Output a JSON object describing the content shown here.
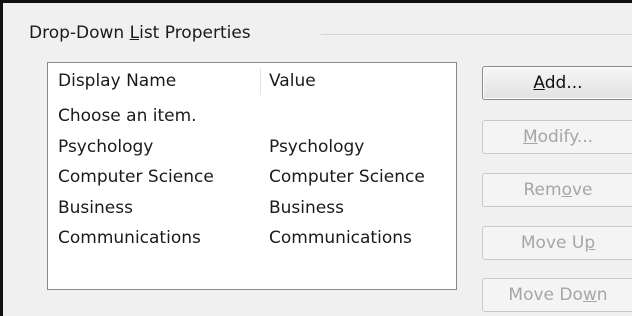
{
  "group": {
    "title_pre": "Drop-Down ",
    "title_mnemonic": "L",
    "title_post": "ist Properties"
  },
  "list": {
    "columns": [
      "Display Name",
      "Value"
    ],
    "rows": [
      {
        "display_name": "Choose an item.",
        "value": ""
      },
      {
        "display_name": "Psychology",
        "value": "Psychology"
      },
      {
        "display_name": "Computer Science",
        "value": "Computer Science"
      },
      {
        "display_name": "Business",
        "value": "Business"
      },
      {
        "display_name": "Communications",
        "value": "Communications"
      }
    ]
  },
  "buttons": {
    "add": {
      "pre": "",
      "mnemonic": "A",
      "post": "dd...",
      "enabled": true
    },
    "modify": {
      "pre": "",
      "mnemonic": "M",
      "post": "odify...",
      "enabled": false
    },
    "remove": {
      "pre": "Rem",
      "mnemonic": "o",
      "post": "ve",
      "enabled": false
    },
    "move_up": {
      "pre": "Move U",
      "mnemonic": "p",
      "post": "",
      "enabled": false
    },
    "move_down": {
      "pre": "Move Do",
      "mnemonic": "w",
      "post": "n",
      "enabled": false
    }
  }
}
